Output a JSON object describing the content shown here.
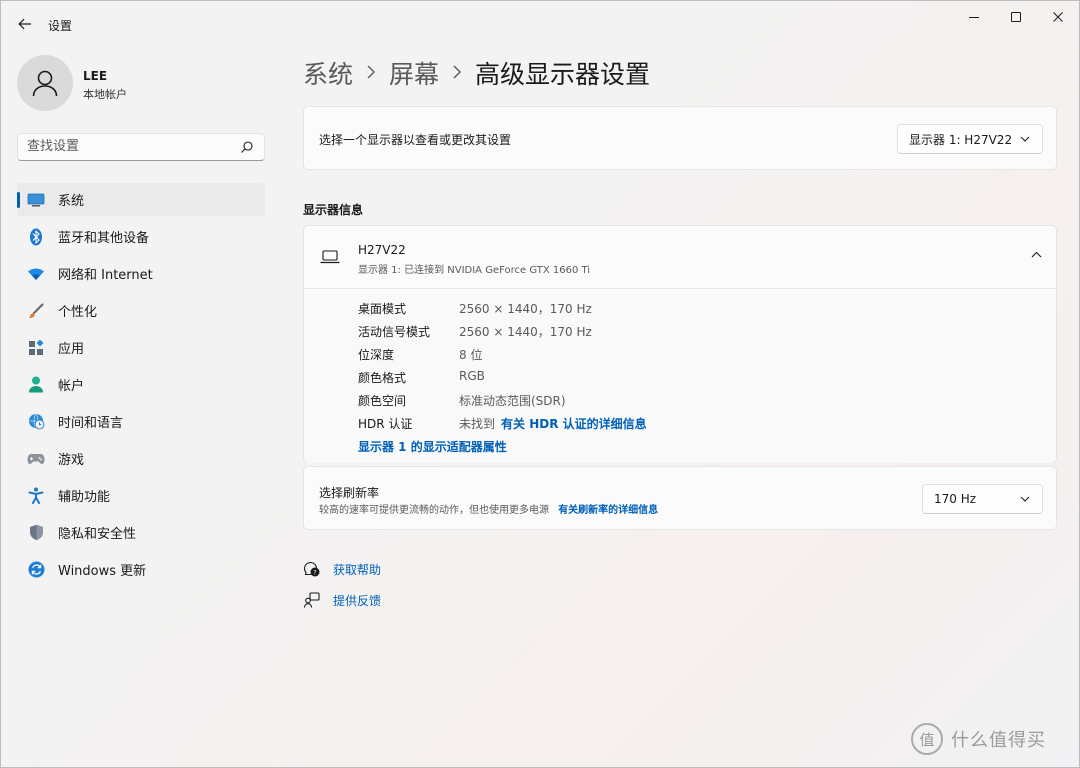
{
  "window": {
    "title": "设置"
  },
  "user": {
    "name": "LEE",
    "account_type": "本地帐户"
  },
  "search": {
    "placeholder": "查找设置"
  },
  "sidebar": {
    "items": [
      {
        "label": "系统",
        "icon": "system-icon",
        "active": true
      },
      {
        "label": "蓝牙和其他设备",
        "icon": "bluetooth-icon"
      },
      {
        "label": "网络和 Internet",
        "icon": "wifi-icon"
      },
      {
        "label": "个性化",
        "icon": "brush-icon"
      },
      {
        "label": "应用",
        "icon": "apps-icon"
      },
      {
        "label": "帐户",
        "icon": "account-icon"
      },
      {
        "label": "时间和语言",
        "icon": "globe-clock-icon"
      },
      {
        "label": "游戏",
        "icon": "gamepad-icon"
      },
      {
        "label": "辅助功能",
        "icon": "accessibility-icon"
      },
      {
        "label": "隐私和安全性",
        "icon": "shield-icon"
      },
      {
        "label": "Windows 更新",
        "icon": "update-icon"
      }
    ]
  },
  "breadcrumb": {
    "part1": "系统",
    "part2": "屏幕",
    "current": "高级显示器设置"
  },
  "display_select": {
    "label": "选择一个显示器以查看或更改其设置",
    "value": "显示器 1: H27V22"
  },
  "display_info": {
    "section_title": "显示器信息",
    "monitor_name": "H27V22",
    "monitor_sub": "显示器 1: 已连接到 NVIDIA GeForce GTX 1660 Ti",
    "rows": [
      {
        "label": "桌面模式",
        "value": "2560 × 1440，170 Hz"
      },
      {
        "label": "活动信号模式",
        "value": "2560 × 1440，170 Hz"
      },
      {
        "label": "位深度",
        "value": "8 位"
      },
      {
        "label": "颜色格式",
        "value": "RGB"
      },
      {
        "label": "颜色空间",
        "value": "标准动态范围(SDR)"
      }
    ],
    "hdr_label": "HDR 认证",
    "hdr_value": "未找到",
    "hdr_link": "有关 HDR 认证的详细信息",
    "adapter_link": "显示器 1 的显示适配器属性"
  },
  "refresh": {
    "title": "选择刷新率",
    "description": "较高的速率可提供更流畅的动作，但也使用更多电源",
    "link": "有关刷新率的详细信息",
    "value": "170 Hz"
  },
  "help": {
    "get_help": "获取帮助",
    "feedback": "提供反馈"
  },
  "watermark": {
    "glyph": "值",
    "text": "什么值得买"
  },
  "colors": {
    "accent": "#005fb8",
    "link": "#0060b8"
  }
}
